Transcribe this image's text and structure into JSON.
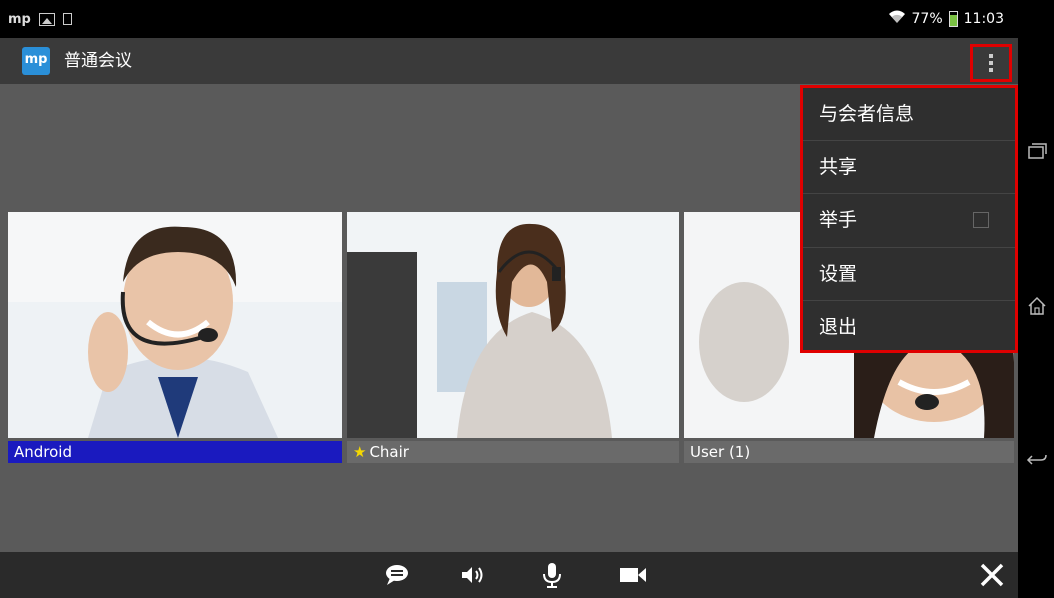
{
  "status_bar": {
    "left_icons": [
      "mp-app-icon",
      "image-icon",
      "square-icon"
    ],
    "mp_text": "mp",
    "wifi_icon": "wifi-icon",
    "battery": "77%",
    "battery_level": 0.77,
    "time": "11:03"
  },
  "app_bar": {
    "logo_text": "mp",
    "title": "普通会议",
    "overflow_icon": "more-vert-icon"
  },
  "participants": [
    {
      "name": "Android",
      "highlight": "#1a1abf",
      "starred": false
    },
    {
      "name": "Chair",
      "highlight": "#6a6a6a",
      "starred": true
    },
    {
      "name": "User (1)",
      "highlight": "#6a6a6a",
      "starred": false
    }
  ],
  "overflow_menu": {
    "items": [
      {
        "label": "与会者信息"
      },
      {
        "label": "共享"
      },
      {
        "label": "举手",
        "checkbox": false
      },
      {
        "label": "设置"
      },
      {
        "label": "退出"
      }
    ],
    "highlight_color": "#e00000"
  },
  "bottom_bar": {
    "icons": [
      "chat-icon",
      "speaker-icon",
      "microphone-icon",
      "video-camera-icon",
      "close-icon"
    ]
  },
  "nav_bar": {
    "icons": [
      "recent-apps-icon",
      "home-icon",
      "back-icon"
    ]
  }
}
